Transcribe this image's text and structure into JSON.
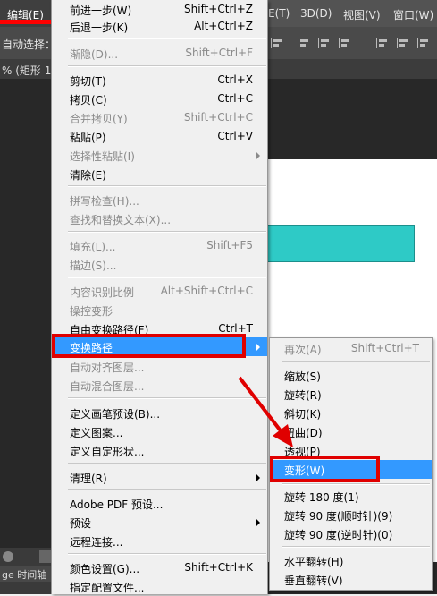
{
  "menubar": {
    "edit": "编辑(E)",
    "layer_fragment": "E(T)",
    "menu_3d": "3D(D)",
    "view": "视图(V)",
    "window": "窗口(W)"
  },
  "options_bar": {
    "auto_select": "自动选择："
  },
  "doc_tab": {
    "label": "% (矩形 1,"
  },
  "bottom_tab": {
    "label": "ge 时间轴"
  },
  "edit_menu": {
    "items": [
      {
        "label": "前进一步(W)",
        "shortcut": "Shift+Ctrl+Z",
        "disabled": false
      },
      {
        "label": "后退一步(K)",
        "shortcut": "Alt+Ctrl+Z",
        "disabled": false
      },
      {
        "label": "渐隐(D)...",
        "shortcut": "Shift+Ctrl+F",
        "disabled": true
      },
      {
        "label": "剪切(T)",
        "shortcut": "Ctrl+X",
        "disabled": false
      },
      {
        "label": "拷贝(C)",
        "shortcut": "Ctrl+C",
        "disabled": false
      },
      {
        "label": "合并拷贝(Y)",
        "shortcut": "Shift+Ctrl+C",
        "disabled": true
      },
      {
        "label": "粘贴(P)",
        "shortcut": "Ctrl+V",
        "disabled": false
      },
      {
        "label": "选择性粘贴(I)",
        "shortcut": "",
        "disabled": true
      },
      {
        "label": "清除(E)",
        "shortcut": "",
        "disabled": false
      },
      {
        "label": "拼写检查(H)...",
        "shortcut": "",
        "disabled": true
      },
      {
        "label": "查找和替换文本(X)...",
        "shortcut": "",
        "disabled": true
      },
      {
        "label": "填充(L)...",
        "shortcut": "Shift+F5",
        "disabled": true
      },
      {
        "label": "描边(S)...",
        "shortcut": "",
        "disabled": true
      },
      {
        "label": "内容识别比例",
        "shortcut": "Alt+Shift+Ctrl+C",
        "disabled": true
      },
      {
        "label": "操控变形",
        "shortcut": "",
        "disabled": true
      },
      {
        "label": "自由变换路径(F)",
        "shortcut": "Ctrl+T",
        "disabled": false
      },
      {
        "label": "变换路径",
        "shortcut": "",
        "disabled": false
      },
      {
        "label": "自动对齐图层...",
        "shortcut": "",
        "disabled": true
      },
      {
        "label": "自动混合图层...",
        "shortcut": "",
        "disabled": true
      },
      {
        "label": "定义画笔预设(B)...",
        "shortcut": "",
        "disabled": false
      },
      {
        "label": "定义图案...",
        "shortcut": "",
        "disabled": false
      },
      {
        "label": "定义自定形状...",
        "shortcut": "",
        "disabled": false
      },
      {
        "label": "清理(R)",
        "shortcut": "",
        "disabled": false
      },
      {
        "label": "Adobe PDF 预设...",
        "shortcut": "",
        "disabled": false
      },
      {
        "label": "预设",
        "shortcut": "",
        "disabled": false
      },
      {
        "label": "远程连接...",
        "shortcut": "",
        "disabled": false
      },
      {
        "label": "颜色设置(G)...",
        "shortcut": "Shift+Ctrl+K",
        "disabled": false
      },
      {
        "label": "指定配置文件...",
        "shortcut": "",
        "disabled": false
      }
    ]
  },
  "transform_submenu": {
    "items": [
      {
        "label": "再次(A)",
        "shortcut": "Shift+Ctrl+T",
        "disabled": true
      },
      {
        "label": "缩放(S)",
        "shortcut": "",
        "disabled": false
      },
      {
        "label": "旋转(R)",
        "shortcut": "",
        "disabled": false
      },
      {
        "label": "斜切(K)",
        "shortcut": "",
        "disabled": false
      },
      {
        "label": "扭曲(D)",
        "shortcut": "",
        "disabled": false
      },
      {
        "label": "透视(P)",
        "shortcut": "",
        "disabled": false
      },
      {
        "label": "变形(W)",
        "shortcut": "",
        "disabled": false
      },
      {
        "label": "旋转 180 度(1)",
        "shortcut": "",
        "disabled": false
      },
      {
        "label": "旋转 90 度(顺时针)(9)",
        "shortcut": "",
        "disabled": false
      },
      {
        "label": "旋转 90 度(逆时针)(0)",
        "shortcut": "",
        "disabled": false
      },
      {
        "label": "水平翻转(H)",
        "shortcut": "",
        "disabled": false
      },
      {
        "label": "垂直翻转(V)",
        "shortcut": "",
        "disabled": false
      }
    ]
  },
  "colors": {
    "highlight": "#3399ff",
    "annotation_red": "#e00000",
    "shape_fill": "#2ecac6"
  }
}
